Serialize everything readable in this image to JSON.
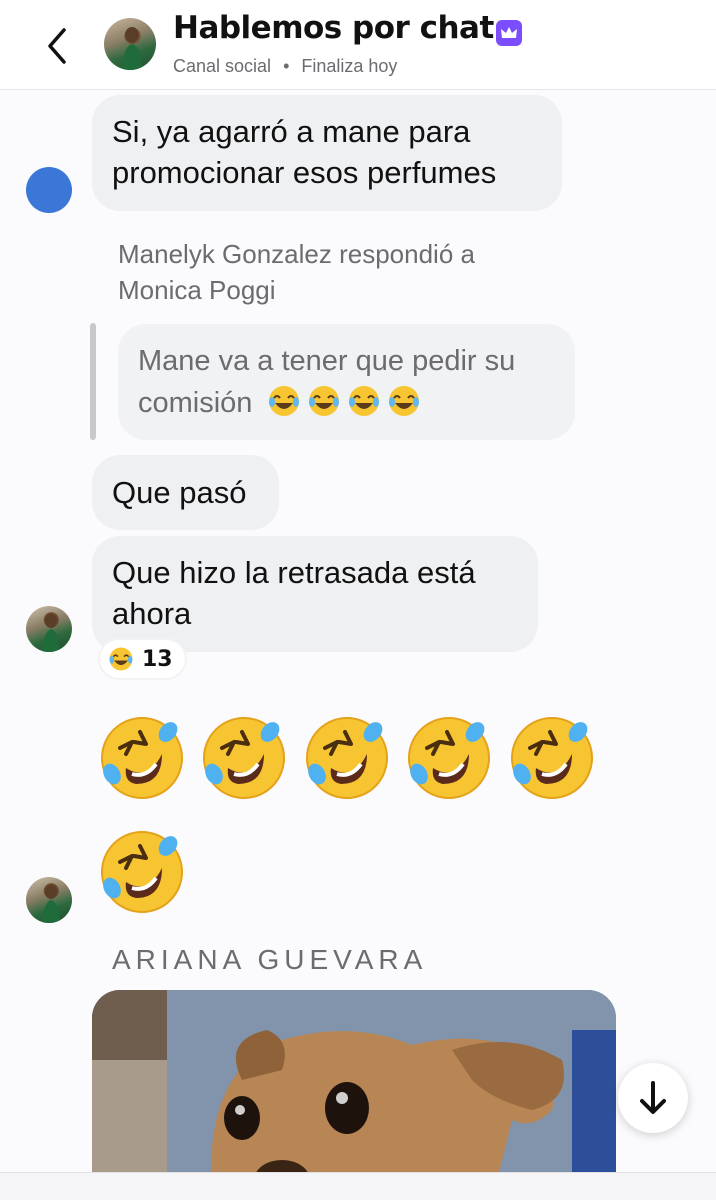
{
  "header": {
    "title": "Hablemos por chat",
    "channel_type": "Canal social",
    "separator": "•",
    "status": "Finaliza hoy",
    "accent_color": "#7c4dff"
  },
  "messages": {
    "message_1": "Si, ya agarró a mane para promocionar esos perfumes",
    "reply_header": "Manelyk Gonzalez respondió a Monica Poggi",
    "quoted_text": "Mane va a tener que pedir su comisión",
    "message_2": "Que pasó",
    "message_3": "Que hizo la retrasada está ahora",
    "reaction_count": "13",
    "sender_name": "ARIANA GUEVARA"
  },
  "icons": {
    "back": "chevron-left-icon",
    "badge": "crown-icon",
    "scroll": "arrow-down-icon",
    "reaction_emoji": "tears-of-joy",
    "big_emoji": "rolling-on-floor-laughing"
  },
  "colors": {
    "bubble_bg": "#eff0f2",
    "avatar_blue": "#3a77d6",
    "muted_text": "#6c6c70"
  }
}
